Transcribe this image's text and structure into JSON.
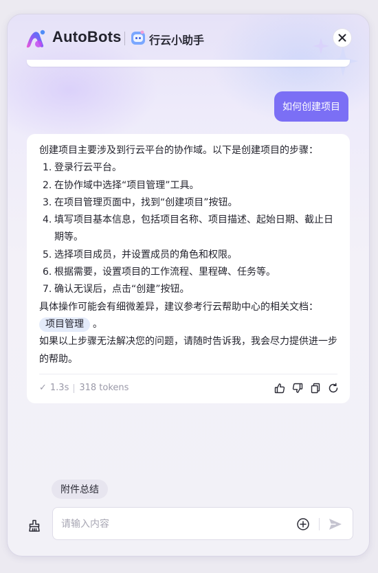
{
  "header": {
    "brand": "AutoBots",
    "bot_name": "行云小助手"
  },
  "conversation": {
    "user_message": "如何创建项目",
    "bot_reply": {
      "intro": "创建项目主要涉及到行云平台的协作域。以下是创建项目的步骤：",
      "steps": [
        {
          "num": "1.",
          "text": "登录行云平台。"
        },
        {
          "num": "2.",
          "text": "在协作域中选择“项目管理”工具。"
        },
        {
          "num": "3.",
          "text": "在项目管理页面中，找到“创建项目”按钮。"
        },
        {
          "num": "4.",
          "text": "填写项目基本信息，包括项目名称、项目描述、起始日期、截止日期等。"
        },
        {
          "num": "5.",
          "text": "选择项目成员，并设置成员的角色和权限。"
        },
        {
          "num": "6.",
          "text": "根据需要，设置项目的工作流程、里程碑、任务等。"
        },
        {
          "num": "7.",
          "text": "确认无误后，点击“创建”按钮。"
        }
      ],
      "note": "具体操作可能会有细微差异，建议参考行云帮助中心的相关文档：",
      "doc_chip": "项目管理",
      "doc_suffix": "。",
      "closing": "如果以上步骤无法解决您的问题，请随时告诉我，我会尽力提供进一步的帮助。",
      "meta": {
        "check_glyph": "✓",
        "duration": "1.3s",
        "tokens": "318 tokens"
      },
      "actions": [
        "thumbs-up-icon",
        "thumbs-down-icon",
        "copy-icon",
        "refresh-icon"
      ]
    }
  },
  "composer": {
    "suggestion": "附件总结",
    "placeholder": "请输入内容"
  },
  "colors": {
    "accent": "#7b6ff5",
    "chip": "#e4ebfa",
    "panel_top": "#e6e2f8"
  }
}
